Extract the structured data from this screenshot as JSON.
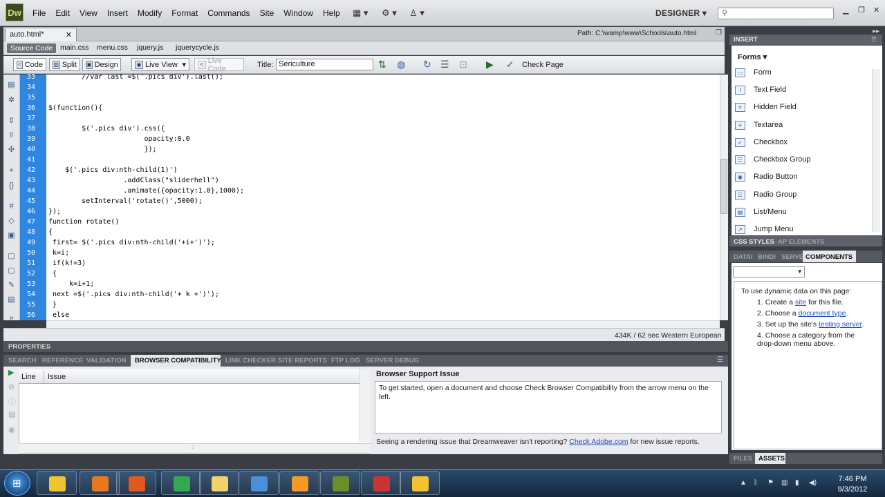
{
  "app": {
    "logo": "Dw",
    "workspace": "DESIGNER",
    "menus": [
      "File",
      "Edit",
      "View",
      "Insert",
      "Modify",
      "Format",
      "Commands",
      "Site",
      "Window",
      "Help"
    ]
  },
  "document": {
    "tab": "auto.html*",
    "path": "Path:  C:\\wamp\\www\\Schools\\auto.html",
    "related_files": [
      "Source Code",
      "main.css",
      "menu.css",
      "jquery.js",
      "jquerycycle.js"
    ]
  },
  "toolbar": {
    "code": "Code",
    "split": "Split",
    "design": "Design",
    "live_view": "Live View",
    "live_code": "Live Code",
    "title_label": "Title:",
    "title_value": "Sericulture",
    "check_page": "Check Page"
  },
  "code": {
    "lines": [
      {
        "n": "33",
        "t": "        //var last =$('.pics div').last();"
      },
      {
        "n": "34",
        "t": ""
      },
      {
        "n": "35",
        "t": ""
      },
      {
        "n": "36",
        "t": "$(function(){"
      },
      {
        "n": "37",
        "t": ""
      },
      {
        "n": "38",
        "t": "        $('.pics div').css({"
      },
      {
        "n": "39",
        "t": "                       opacity:0.0"
      },
      {
        "n": "40",
        "t": "                       });"
      },
      {
        "n": "41",
        "t": ""
      },
      {
        "n": "42",
        "t": "    $('.pics div:nth-child(1)')"
      },
      {
        "n": "43",
        "t": "                  .addClass(\"sliderhell\")"
      },
      {
        "n": "44",
        "t": "                  .animate({opacity:1.0},1000);"
      },
      {
        "n": "45",
        "t": "        setInterval('rotate()',5000);"
      },
      {
        "n": "46",
        "t": "});"
      },
      {
        "n": "47",
        "t": "function rotate()"
      },
      {
        "n": "48",
        "t": "{"
      },
      {
        "n": "49",
        "t": " first= $('.pics div:nth-child('+i+')');"
      },
      {
        "n": "50",
        "t": " k=i;"
      },
      {
        "n": "51",
        "t": " if(k!=3)"
      },
      {
        "n": "52",
        "t": " {"
      },
      {
        "n": "53",
        "t": "     k=i+1;"
      },
      {
        "n": "54",
        "t": " next =$('.pics div:nth-child('+ k +')');"
      },
      {
        "n": "55",
        "t": " }"
      },
      {
        "n": "56",
        "t": " else"
      }
    ]
  },
  "status": {
    "text": "434K / 62 sec  Western European"
  },
  "panels": {
    "properties": "PROPERTIES",
    "results_tabs": [
      "SEARCH",
      "REFERENCE",
      "VALIDATION",
      "BROWSER COMPATIBILITY",
      "LINK CHECKER",
      "SITE REPORTS",
      "FTP LOG",
      "SERVER DEBUG"
    ],
    "table_cols": [
      "Line",
      "Issue"
    ]
  },
  "browser_support": {
    "title": "Browser Support Issue",
    "body": "To get started, open a document and choose Check Browser Compatibility from the arrow menu on the left.",
    "footer_pre": "Seeing a rendering issue that Dreamweaver isn't reporting?",
    "footer_link": "Check Adobe.com",
    "footer_post": "for new issue reports."
  },
  "insert": {
    "header": "INSERT",
    "category": "Forms",
    "items": [
      "Form",
      "Text Field",
      "Hidden Field",
      "Textarea",
      "Checkbox",
      "Checkbox Group",
      "Radio Button",
      "Radio Group",
      "List/Menu",
      "Jump Menu"
    ]
  },
  "css_tabs": [
    "CSS STYLES",
    "AP ELEMENTS"
  ],
  "comp_tabs": [
    "DATAI",
    "BINDI",
    "SERVE",
    "COMPONENTS"
  ],
  "components": {
    "intro": "To use dynamic data on this page:",
    "steps": [
      {
        "n": "1.",
        "pre": "Create a ",
        "link": "site",
        "post": " for this file."
      },
      {
        "n": "2.",
        "pre": "Choose a ",
        "link": "document type",
        "post": "."
      },
      {
        "n": "3.",
        "pre": "Set up the site's ",
        "link": "testing server",
        "post": "."
      },
      {
        "n": "4.",
        "pre": "Choose a category from the drop-down menu above.",
        "link": "",
        "post": ""
      }
    ]
  },
  "files_tabs": [
    "FILES",
    "ASSETS"
  ],
  "clock": {
    "time": "7:46 PM",
    "date": "9/3/2012"
  },
  "taskbar_colors": [
    "#f1c232",
    "#e87722",
    "#e25822",
    "#34a853",
    "#f2d16b",
    "#4a90d9",
    "#f59a23",
    "#6a8f2a",
    "#cc3333"
  ]
}
